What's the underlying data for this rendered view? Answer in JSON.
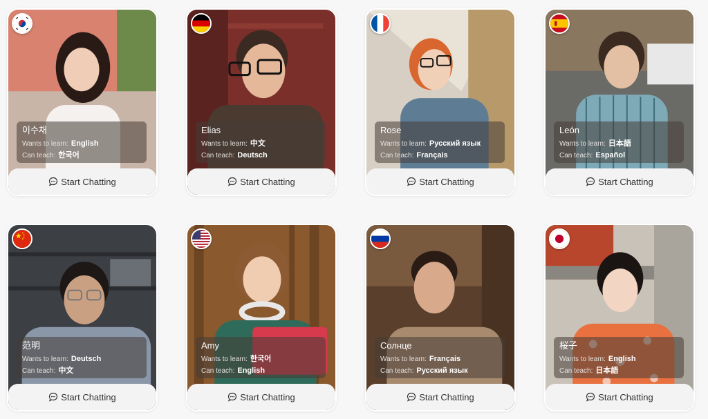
{
  "cards": [
    {
      "name": "이수채",
      "wants_label": "Wants to learn:",
      "wants": "English",
      "teach_label": "Can teach:",
      "teach": "한국어",
      "flag": "south-korea",
      "button": "Start Chatting"
    },
    {
      "name": "Elias",
      "wants_label": "Wants to learn:",
      "wants": "中文",
      "teach_label": "Can teach:",
      "teach": "Deutsch",
      "flag": "germany",
      "button": "Start Chatting"
    },
    {
      "name": "Rose",
      "wants_label": "Wants to learn:",
      "wants": "Русский язык",
      "teach_label": "Can teach:",
      "teach": "Français",
      "flag": "france",
      "button": "Start Chatting"
    },
    {
      "name": "León",
      "wants_label": "Wants to learn:",
      "wants": "日本語",
      "teach_label": "Can teach:",
      "teach": "Español",
      "flag": "spain",
      "button": "Start Chatting"
    },
    {
      "name": "范明",
      "wants_label": "Wants to learn:",
      "wants": "Deutsch",
      "teach_label": "Can teach:",
      "teach": "中文",
      "flag": "china",
      "button": "Start Chatting"
    },
    {
      "name": "Amy",
      "wants_label": "Wants to learn:",
      "wants": "한국어",
      "teach_label": "Can teach:",
      "teach": "English",
      "flag": "usa",
      "button": "Start Chatting"
    },
    {
      "name": "Солнце",
      "wants_label": "Wants to learn:",
      "wants": "Français",
      "teach_label": "Can teach:",
      "teach": "Русский язык",
      "flag": "russia",
      "button": "Start Chatting"
    },
    {
      "name": "桜子",
      "wants_label": "Wants to learn:",
      "wants": "English",
      "teach_label": "Can teach:",
      "teach": "日本語",
      "flag": "japan",
      "button": "Start Chatting"
    }
  ],
  "colors": {
    "page_bg": "#f7f7f8",
    "info_overlay": "rgba(70,60,55,0.55)",
    "button_bg": "#f3f3f4"
  },
  "icons": {
    "button_icon": "chat-bubble-icon"
  }
}
